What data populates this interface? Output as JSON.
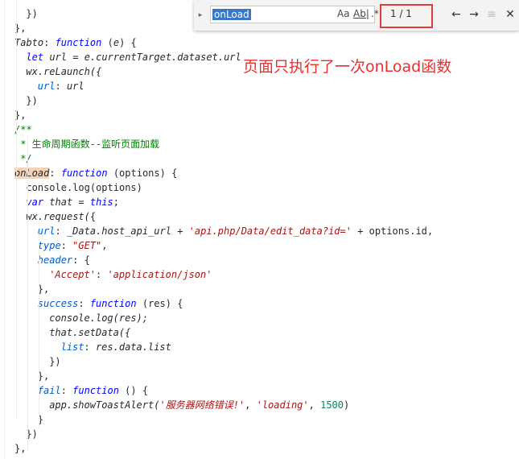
{
  "code_lines": [
    [
      "    ",
      {
        "t": "})",
        "c": ""
      }
    ],
    [
      "  ",
      {
        "t": "},",
        "c": ""
      }
    ],
    [
      "  ",
      {
        "t": "Tabto",
        "c": "t-it"
      },
      {
        "t": ": ",
        "c": ""
      },
      {
        "t": "function",
        "c": "t-kw"
      },
      {
        "t": " (",
        "c": ""
      },
      {
        "t": "e",
        "c": "t-it"
      },
      {
        "t": ") {",
        "c": ""
      }
    ],
    [
      "    ",
      {
        "t": "let",
        "c": "t-kw"
      },
      {
        "t": " ",
        "c": ""
      },
      {
        "t": "url",
        "c": "t-it"
      },
      {
        "t": " = ",
        "c": ""
      },
      {
        "t": "e.currentTarget.dataset.url",
        "c": "t-it"
      }
    ],
    [
      "    ",
      {
        "t": "wx.reLaunch({",
        "c": "t-it"
      }
    ],
    [
      "      ",
      {
        "t": "url",
        "c": "t-prop"
      },
      {
        "t": ": ",
        "c": ""
      },
      {
        "t": "url",
        "c": "t-it"
      }
    ],
    [
      "    ",
      {
        "t": "})",
        "c": ""
      }
    ],
    [
      "  ",
      {
        "t": "},",
        "c": ""
      }
    ],
    [
      "  ",
      {
        "t": "/**",
        "c": "t-cmt"
      }
    ],
    [
      "   ",
      {
        "t": "* 生命周期函数--监听页面加载",
        "c": "t-cmtz"
      }
    ],
    [
      "   ",
      {
        "t": "*/",
        "c": "t-cmt"
      }
    ],
    [
      "  ",
      {
        "t": "onLoad",
        "c": "t-it t-hl"
      },
      {
        "t": ": ",
        "c": ""
      },
      {
        "t": "function",
        "c": "t-kw"
      },
      {
        "t": " (options) {",
        "c": ""
      }
    ],
    [
      "    ",
      {
        "t": "console.log(options)",
        "c": ""
      }
    ],
    [
      "    ",
      {
        "t": "var",
        "c": "t-kw"
      },
      {
        "t": " that = ",
        "c": "t-it"
      },
      {
        "t": "this",
        "c": "t-kw"
      },
      {
        "t": ";",
        "c": ""
      }
    ],
    [
      "    ",
      {
        "t": "wx.request(",
        "c": "t-it"
      },
      {
        "t": "{",
        "c": ""
      }
    ],
    [
      "      ",
      {
        "t": "url",
        "c": "t-prop"
      },
      {
        "t": ": ",
        "c": ""
      },
      {
        "t": "_Data.host_api_url",
        "c": "t-it"
      },
      {
        "t": " + ",
        "c": ""
      },
      {
        "t": "'api.php/Data/edit_data?id='",
        "c": "t-str"
      },
      {
        "t": " + options.id,",
        "c": ""
      }
    ],
    [
      "      ",
      {
        "t": "type",
        "c": "t-prop"
      },
      {
        "t": ": ",
        "c": ""
      },
      {
        "t": "\"GET\"",
        "c": "t-str"
      },
      {
        "t": ",",
        "c": ""
      }
    ],
    [
      "      ",
      {
        "t": "header",
        "c": "t-prop"
      },
      {
        "t": ": {",
        "c": ""
      }
    ],
    [
      "        ",
      {
        "t": "'Accept'",
        "c": "t-str"
      },
      {
        "t": ": ",
        "c": ""
      },
      {
        "t": "'application/json'",
        "c": "t-str"
      }
    ],
    [
      "      ",
      {
        "t": "},",
        "c": ""
      }
    ],
    [
      "      ",
      {
        "t": "success",
        "c": "t-prop"
      },
      {
        "t": ": ",
        "c": ""
      },
      {
        "t": "function",
        "c": "t-kw"
      },
      {
        "t": " (res) {",
        "c": ""
      }
    ],
    [
      "        ",
      {
        "t": "console.log(res);",
        "c": "t-it"
      }
    ],
    [
      "        ",
      {
        "t": "that.setData({",
        "c": "t-it"
      }
    ],
    [
      "          ",
      {
        "t": "list",
        "c": "t-prop"
      },
      {
        "t": ": ",
        "c": ""
      },
      {
        "t": "res.data.list",
        "c": "t-it"
      }
    ],
    [
      "        ",
      {
        "t": "})",
        "c": ""
      }
    ],
    [
      "      ",
      {
        "t": "},",
        "c": ""
      }
    ],
    [
      "      ",
      {
        "t": "fail",
        "c": "t-prop"
      },
      {
        "t": ": ",
        "c": ""
      },
      {
        "t": "function",
        "c": "t-kw"
      },
      {
        "t": " () {",
        "c": ""
      }
    ],
    [
      "        ",
      {
        "t": "app.showToastAlert(",
        "c": "t-it"
      },
      {
        "t": "'服务器网络错误!'",
        "c": "t-str"
      },
      {
        "t": ", ",
        "c": ""
      },
      {
        "t": "'loading'",
        "c": "t-str"
      },
      {
        "t": ", ",
        "c": ""
      },
      {
        "t": "1500",
        "c": "t-num"
      },
      {
        "t": ")",
        "c": ""
      }
    ],
    [
      "      ",
      {
        "t": "}",
        "c": ""
      }
    ],
    [
      "    ",
      {
        "t": "})",
        "c": ""
      }
    ],
    [
      "  ",
      {
        "t": "},",
        "c": ""
      }
    ]
  ],
  "find_widget": {
    "query": "onLoad",
    "match_case": "Aa",
    "whole_word": "Ab|",
    "regex": ".*",
    "match_count": "1 / 1",
    "prev_icon": "arrow-up-icon",
    "next_icon": "arrow-down-icon",
    "selection_icon": "find-in-selection-icon",
    "close_icon": "close-icon",
    "prev_glyph": "←",
    "next_glyph": "→",
    "selection_glyph": "≡",
    "close_glyph": "✕",
    "toggle_glyph": "▸"
  },
  "annotation": {
    "text": "页面只执行了一次onLoad函数",
    "color": "#ee2c2c"
  }
}
